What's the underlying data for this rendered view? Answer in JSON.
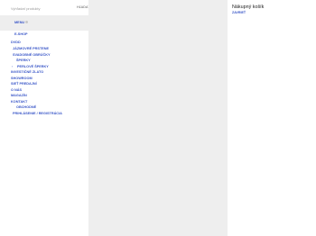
{
  "search": {
    "placeholder": "Vyhľadať produkty",
    "button_label": "HĽADAŤ"
  },
  "menu": {
    "label": "MENU"
  },
  "nav": {
    "eshop": "E-SHOP",
    "items": [
      "DVDD",
      "JÁZMOVRÉ PRSTENE",
      "SVADOBNÉ OBRÚČKY",
      "ŠPERKY",
      "PERLOVÉ ŠPERKY",
      "INVESTIČNÉ ZLATO",
      "SHOWROOM",
      "SIEŤ PREDAJNÍ",
      "O NÁS",
      "MAGAZÍN",
      "KONTAKT",
      "OBCHODNÉ",
      "PRIHLÁSENIE / REGISTRÁCIA"
    ]
  },
  "cart": {
    "title": "Nákupný košík",
    "close_label": "ZAVRIEŤ"
  },
  "colors": {
    "link": "#3a57c8",
    "panel_grey": "#eeeeee"
  }
}
